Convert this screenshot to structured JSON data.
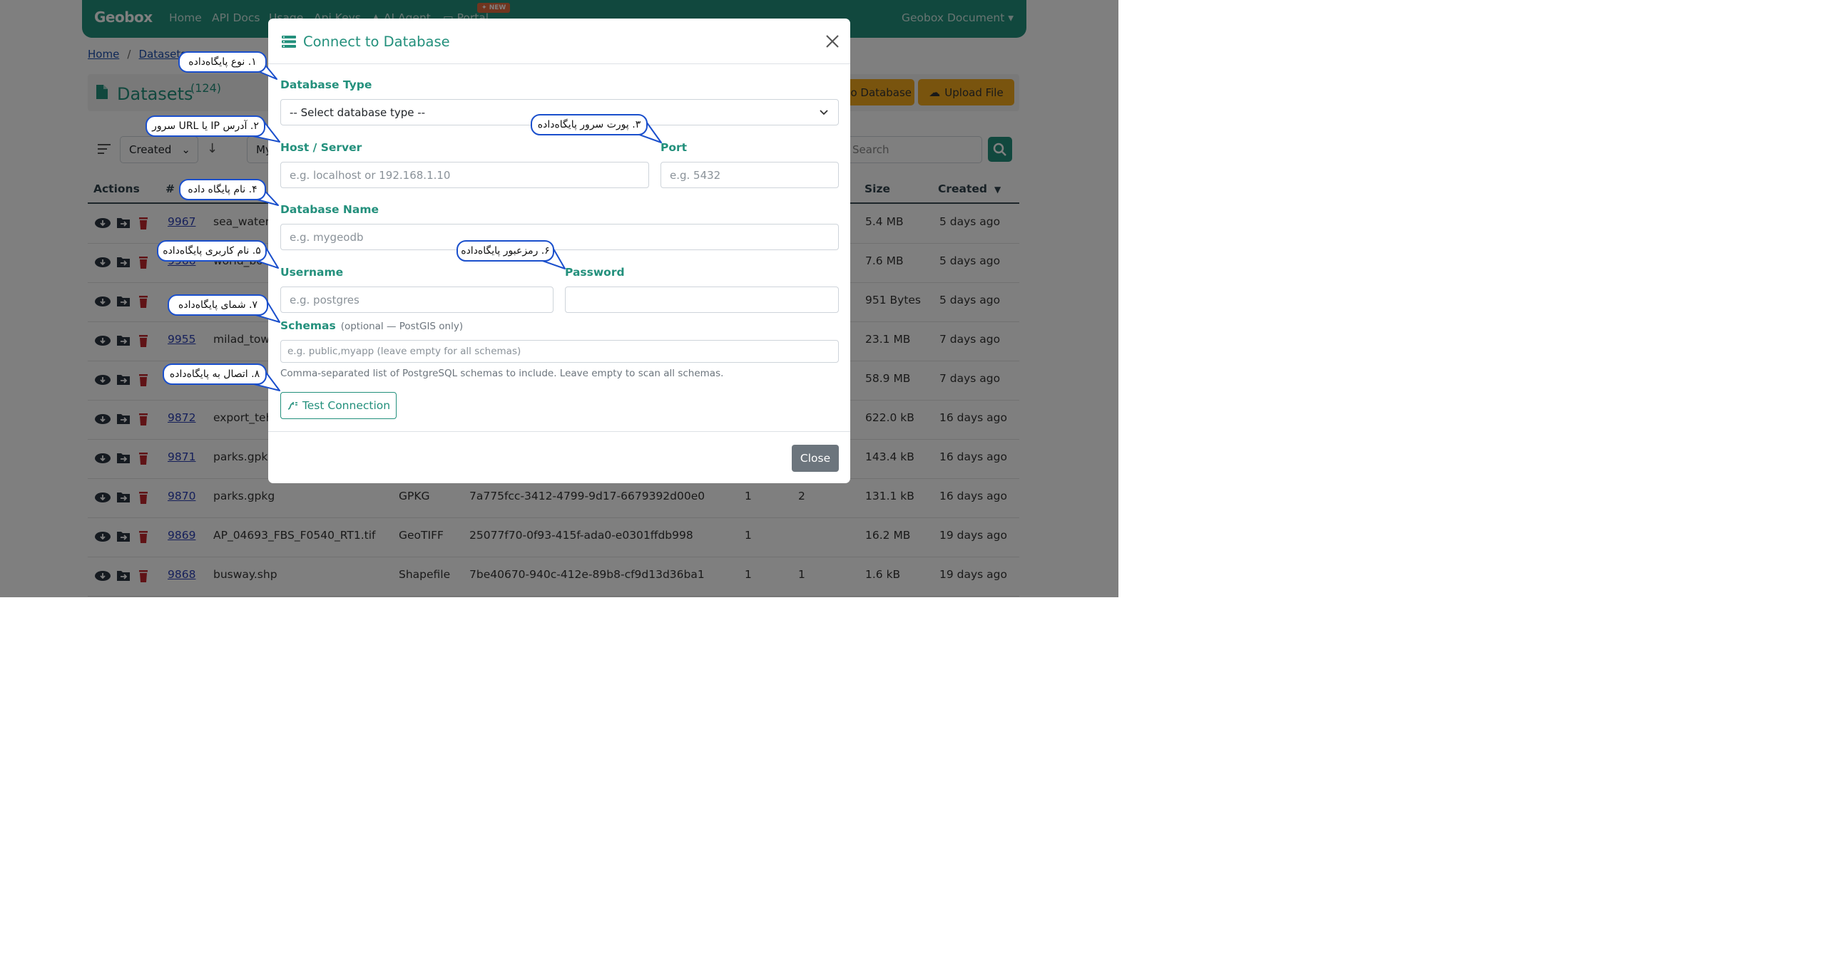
{
  "navbar": {
    "logo": "Geobox",
    "links": [
      "Home",
      "API Docs",
      "Usage",
      "Api Keys",
      "AI Agent",
      "Portal"
    ],
    "new_badge": "NEW",
    "right_menu": "Geobox Document"
  },
  "breadcrumb": [
    "Home",
    "/",
    "Datasets"
  ],
  "datasets_header": {
    "title": "Datasets",
    "count": "(124)",
    "connect_button": "o Database",
    "upload_button": "Upload File"
  },
  "toolbar": {
    "sort_select": "Created",
    "filter_partial": "My",
    "search_placeholder": "Search"
  },
  "table": {
    "headers": {
      "actions": "Actions",
      "num": "#",
      "size": "Size",
      "created": "Created"
    },
    "rows": [
      {
        "id": "9967",
        "name": "sea_water.s",
        "type": "",
        "uuid": "",
        "c1": "",
        "c2": "",
        "size": "5.4 MB",
        "created": "5 days ago"
      },
      {
        "id": "9966",
        "name": "world_bo",
        "type": "",
        "uuid": "",
        "c1": "",
        "c2": "",
        "size": "7.6 MB",
        "created": "5 days ago"
      },
      {
        "id": "",
        "name": "",
        "type": "",
        "uuid": "",
        "c1": "",
        "c2": "",
        "size": "951 Bytes",
        "created": "5 days ago"
      },
      {
        "id": "9955",
        "name": "milad_towe",
        "type": "",
        "uuid": "",
        "c1": "",
        "c2": "",
        "size": "23.1 MB",
        "created": "7 days ago"
      },
      {
        "id": "",
        "name": "",
        "type": "",
        "uuid": "",
        "c1": "",
        "c2": "",
        "size": "58.9 MB",
        "created": "7 days ago"
      },
      {
        "id": "9872",
        "name": "export_teh",
        "type": "",
        "uuid": "",
        "c1": "",
        "c2": "",
        "size": "622.0 kB",
        "created": "16 days ago"
      },
      {
        "id": "9871",
        "name": "parks.gpkg",
        "type": "",
        "uuid": "",
        "c1": "",
        "c2": "",
        "size": "143.4 kB",
        "created": "16 days ago"
      },
      {
        "id": "9870",
        "name": "parks.gpkg",
        "type": "GPKG",
        "uuid": "7a775fcc-3412-4799-9d17-6679392d00e0",
        "c1": "1",
        "c2": "2",
        "size": "131.1 kB",
        "created": "16 days ago"
      },
      {
        "id": "9869",
        "name": "AP_04693_FBS_F0540_RT1.tif",
        "type": "GeoTIFF",
        "uuid": "25077f70-0f93-415f-ada0-e0301ffdb998",
        "c1": "1",
        "c2": "",
        "size": "16.2 MB",
        "created": "19 days ago"
      },
      {
        "id": "9868",
        "name": "busway.shp",
        "type": "Shapefile",
        "uuid": "7be40670-940c-412e-89b8-cf9d13d36ba1",
        "c1": "1",
        "c2": "1",
        "size": "1.6 kB",
        "created": "19 days ago"
      }
    ]
  },
  "modal": {
    "title": "Connect to Database",
    "db_type_label": "Database Type",
    "db_type_value": "-- Select database type --",
    "host_label": "Host / Server",
    "host_placeholder": "e.g. localhost or 192.168.1.10",
    "port_label": "Port",
    "port_placeholder": "e.g. 5432",
    "dbname_label": "Database Name",
    "dbname_placeholder": "e.g. mygeodb",
    "username_label": "Username",
    "username_placeholder": "e.g. postgres",
    "password_label": "Password",
    "password_placeholder": "",
    "schemas_label": "Schemas",
    "schemas_hint": "(optional — PostGIS only)",
    "schemas_placeholder": "e.g. public,myapp  (leave empty for all schemas)",
    "schemas_help": "Comma-separated list of PostgreSQL schemas to include. Leave empty to scan all schemas.",
    "test_button": "Test Connection",
    "close_button": "Close"
  },
  "callouts": [
    "۱. نوع پایگاه‌داده",
    "۲. آدرس IP یا URL سرور",
    "۳. پورت سرور پایگاه‌داده",
    "۴. نام پایگاه داده",
    "۵. نام کاربری پایگاه‌داده",
    "۶. رمزعبور پایگاه‌داده",
    "۷. شمای پایگاه‌داده",
    "۸. اتصال به پایگاه‌داده"
  ],
  "colors": {
    "brand": "#23907c",
    "accent_button": "#f3a81d",
    "link": "#2a3fb5",
    "delete": "#c0262d",
    "callout_border": "#1a4fcc",
    "close_button": "#6c757d"
  }
}
